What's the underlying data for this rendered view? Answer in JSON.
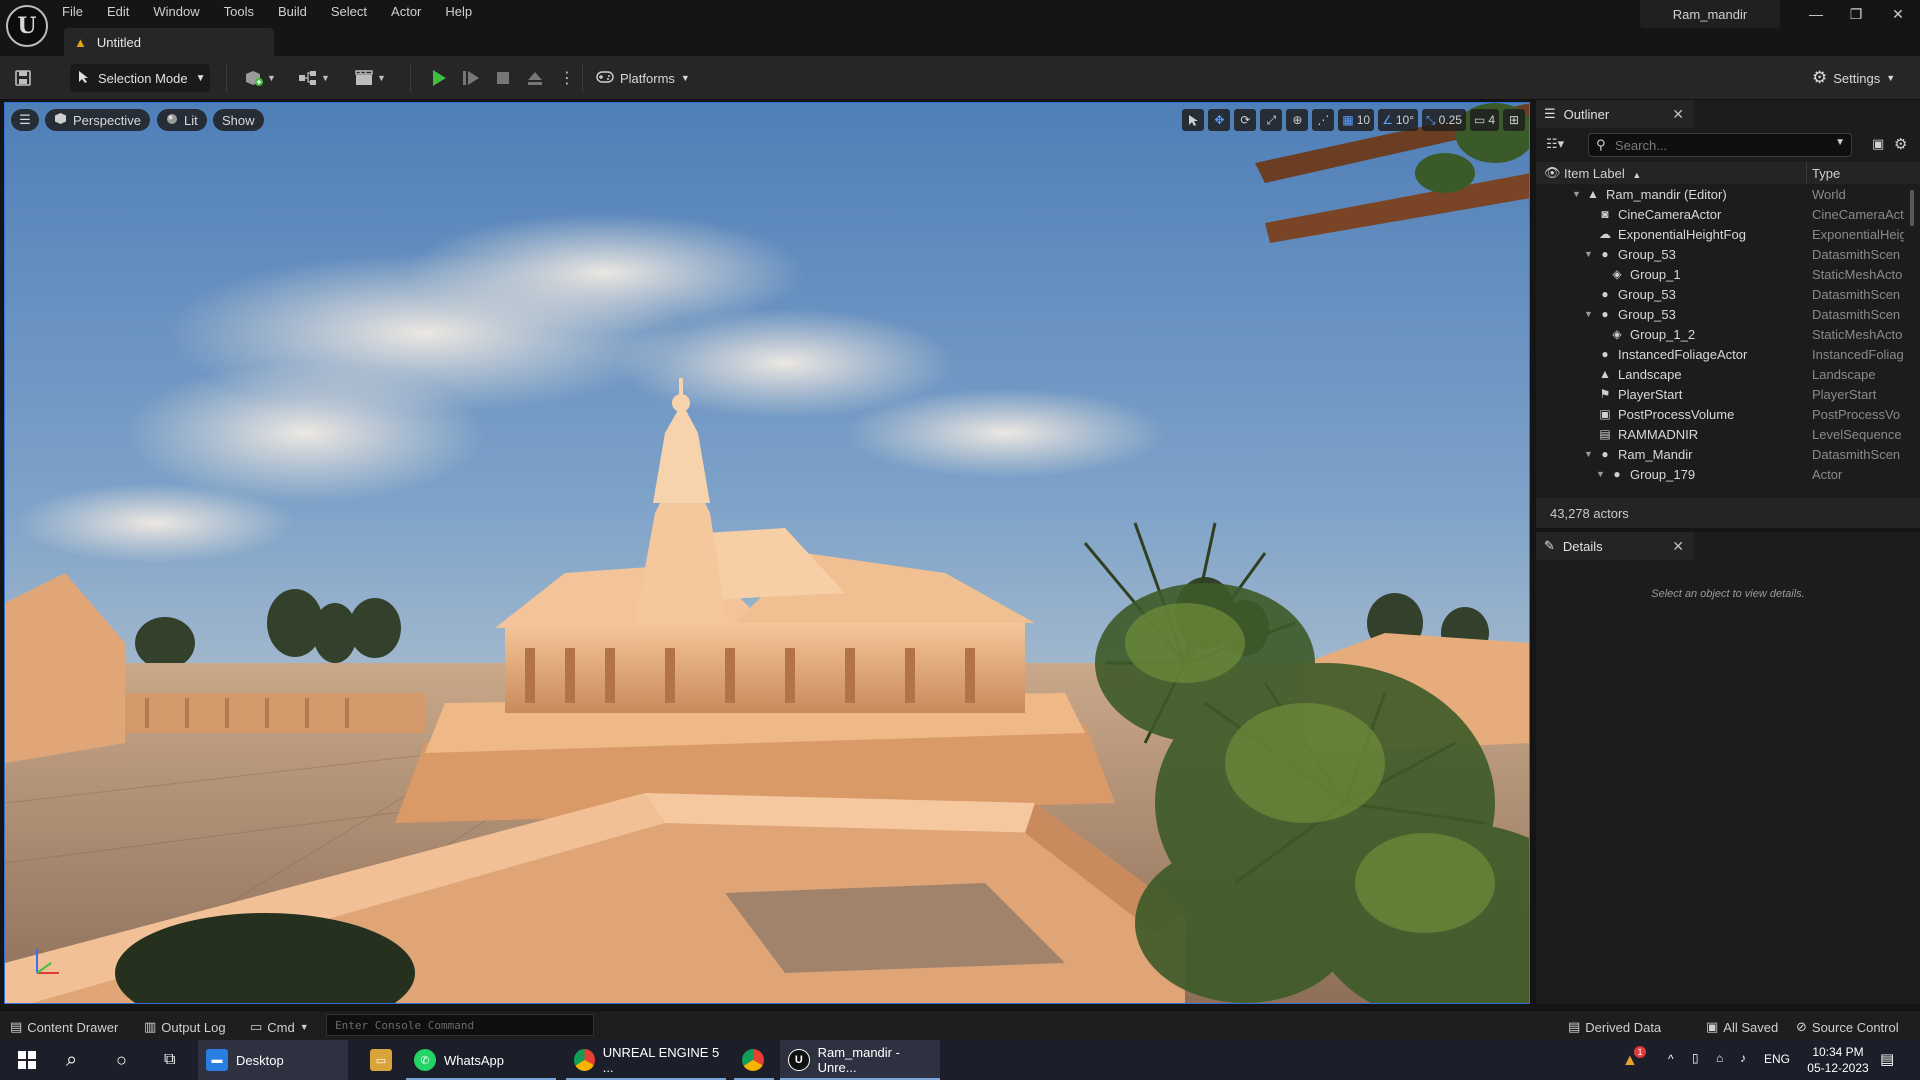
{
  "app": {
    "logo_letter": "U",
    "menu": [
      "File",
      "Edit",
      "Window",
      "Tools",
      "Build",
      "Select",
      "Actor",
      "Help"
    ],
    "document_tab": "Untitled",
    "project_name": "Ram_mandir"
  },
  "toolbar": {
    "selection_mode": "Selection Mode",
    "platforms": "Platforms",
    "settings": "Settings"
  },
  "viewport": {
    "view_mode": "Perspective",
    "lighting": "Lit",
    "show": "Show",
    "grid_snap": "10",
    "rotation_snap": "10°",
    "scale_snap": "0.25",
    "camera_speed": "4"
  },
  "outliner": {
    "title": "Outliner",
    "search_placeholder": "Search...",
    "col_label": "Item Label",
    "col_type": "Type",
    "items": [
      {
        "label": "Ram_mandir (Editor)",
        "type": "World",
        "icon": "world-icon"
      },
      {
        "label": "CineCameraActor",
        "type": "CineCameraAct",
        "icon": "camera-icon"
      },
      {
        "label": "ExponentialHeightFog",
        "type": "ExponentialHeig",
        "icon": "fog-icon"
      },
      {
        "label": "Group_53",
        "type": "DatasmithScen",
        "icon": "actor-icon"
      },
      {
        "label": "Group_1",
        "type": "StaticMeshActo",
        "icon": "mesh-icon"
      },
      {
        "label": "Group_53",
        "type": "DatasmithScen",
        "icon": "actor-icon"
      },
      {
        "label": "Group_53",
        "type": "DatasmithScen",
        "icon": "actor-icon"
      },
      {
        "label": "Group_1_2",
        "type": "StaticMeshActo",
        "icon": "mesh-icon"
      },
      {
        "label": "InstancedFoliageActor",
        "type": "InstancedFoliag",
        "icon": "actor-icon"
      },
      {
        "label": "Landscape",
        "type": "Landscape",
        "icon": "landscape-icon"
      },
      {
        "label": "PlayerStart",
        "type": "PlayerStart",
        "icon": "player-start-icon"
      },
      {
        "label": "PostProcessVolume",
        "type": "PostProcessVo",
        "icon": "volume-icon"
      },
      {
        "label": "RAMMADNIR",
        "type": "LevelSequence",
        "icon": "sequence-icon"
      },
      {
        "label": "Ram_Mandir",
        "type": "DatasmithScen",
        "icon": "actor-icon"
      },
      {
        "label": "Group_179",
        "type": "Actor",
        "icon": "actor-icon"
      }
    ],
    "actor_count": "43,278 actors"
  },
  "details": {
    "title": "Details",
    "empty_message": "Select an object to view details."
  },
  "statusbar": {
    "content_drawer": "Content Drawer",
    "output_log": "Output Log",
    "cmd": "Cmd",
    "console_placeholder": "Enter Console Command",
    "derived_data": "Derived Data",
    "all_saved": "All Saved",
    "source_control": "Source Control"
  },
  "taskbar": {
    "desktop": "Desktop",
    "whatsapp": "WhatsApp",
    "chrome_ue": "UNREAL ENGINE 5 ...",
    "ue_window": "Ram_mandir - Unre...",
    "lang": "ENG",
    "time": "10:34 PM",
    "date": "05-12-2023",
    "notification_count": "1"
  },
  "colors": {
    "accent_blue": "#2f6fd8",
    "play_green": "#3fbf3f",
    "warning": "#e1a31a"
  }
}
